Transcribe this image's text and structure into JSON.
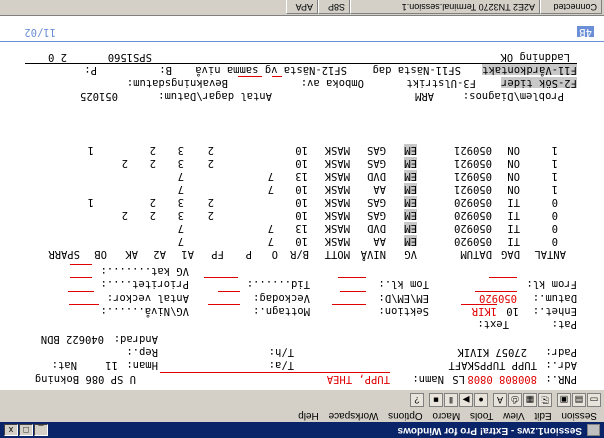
{
  "window": {
    "title": "Session1.zws - Extra! Pro for Windows",
    "menu": [
      "Session",
      "Edit",
      "View",
      "Tools",
      "Macro",
      "Options",
      "Workspace",
      "Help"
    ]
  },
  "header_fields": {
    "pnr_label": "PNR.:",
    "pnr_value": "800808 0808",
    "ls_label": "LS",
    "namn_label": "Namn:",
    "namn_value": "TUPP, THEA",
    "right_info": "U SP 086 Bokning",
    "adr_label": "Adr.:",
    "adr_value": "TUPP TUPPSKAFT",
    "t_a_label": "T/a:",
    "hman_label": "Hman:",
    "hman_value": "11",
    "nat_label": "Nat:",
    "padr_label": "Padr:",
    "padr_value": "27057 KIVIK",
    "t_h_label": "T/h:",
    "rep_label": "Rep.:",
    "andrad_label": "Andrad:",
    "andrad_value": "040622 BDN",
    "pat_label": "Pat:",
    "text_label": "Text:",
    "enhet_label": "Enhet.:",
    "enhet_value": "10",
    "enhet_code": "1KIR",
    "sektion_label": "Sektion:",
    "mottagn_label": "Mottagn.:",
    "vg_niva_label": "VG\\Nivå......:",
    "datum_label": "Datum.:",
    "datum_value": "050920",
    "em_label": "EM\\EM\\D:",
    "veckodag_label": "Veckodag:",
    "antal_veckor_label": "Antal veckor:",
    "from_kl_label": "From kl:",
    "tom_kl_label": "Tom kl.:",
    "tid_label": "Tid......:",
    "prioritet_label": "Prioritet....:",
    "vg_kat_label": "VG kat.......:"
  },
  "table": {
    "headers": [
      "ANTAL",
      "DAG",
      "DATUM",
      "VG",
      "NIVÅ",
      "MOTT",
      "B/R",
      "O",
      "P",
      "FP",
      "A1",
      "A2",
      "AK",
      "OB",
      "SPARR"
    ],
    "rows": [
      [
        "0",
        "TI",
        "050920",
        "EM",
        "AA",
        "MASK",
        "10",
        "7",
        "",
        "7",
        "",
        "",
        ""
      ],
      [
        "0",
        "TI",
        "050920",
        "EM",
        "DVD",
        "MASK",
        "13",
        "7",
        "",
        "7",
        "",
        "",
        ""
      ],
      [
        "0",
        "TI",
        "050920",
        "EM",
        "GAS",
        "MASK",
        "10",
        "",
        "2",
        "3",
        "2",
        "2",
        ""
      ],
      [
        "0",
        "TI",
        "050920",
        "EM",
        "GAS",
        "MASK",
        "10",
        "",
        "2",
        "3",
        "2",
        "",
        "1"
      ],
      [
        "1",
        "ON",
        "050921",
        "EM",
        "AA",
        "MASK",
        "10",
        "7",
        "",
        "7",
        "",
        "",
        ""
      ],
      [
        "1",
        "ON",
        "050921",
        "EM",
        "DVD",
        "MASK",
        "13",
        "7",
        "",
        "7",
        "",
        "",
        ""
      ],
      [
        "1",
        "ON",
        "050921",
        "EM",
        "GAS",
        "MASK",
        "10",
        "",
        "2",
        "3",
        "2",
        "2",
        ""
      ],
      [
        "1",
        "ON",
        "050921",
        "EM",
        "GAS",
        "MASK",
        "10",
        "",
        "2",
        "3",
        "2",
        "",
        "1"
      ]
    ]
  },
  "footer": {
    "problem_label": "Problem\\Diagnos:",
    "problem_value": "ARM",
    "antal_label": "Antal dagar\\Datum:",
    "antal_value": "051025",
    "f2_label": "F2-Sök tider",
    "f3_label": "F3-Ulstrikt",
    "omboka_label": "Omboka av:",
    "bevakningsdatum_label": "Bevakningsdatum:",
    "f11_label": "F11-Vårdkontakt",
    "sf11_label": "SF11-Nästa dag",
    "sf12_label": "SF12-Nästa vg samma nivå",
    "b_label": "B:",
    "p_label": "P:",
    "ladning_text": "Laddning OK",
    "terminal_id": "SPS1560",
    "terminal_page": "2 0"
  },
  "oia": {
    "left": "4B",
    "right": "11/02"
  },
  "statusbar": {
    "cells": [
      "Connected",
      "A2E2 TN3270 Terminal.session.1",
      "S8P",
      "APA"
    ]
  }
}
